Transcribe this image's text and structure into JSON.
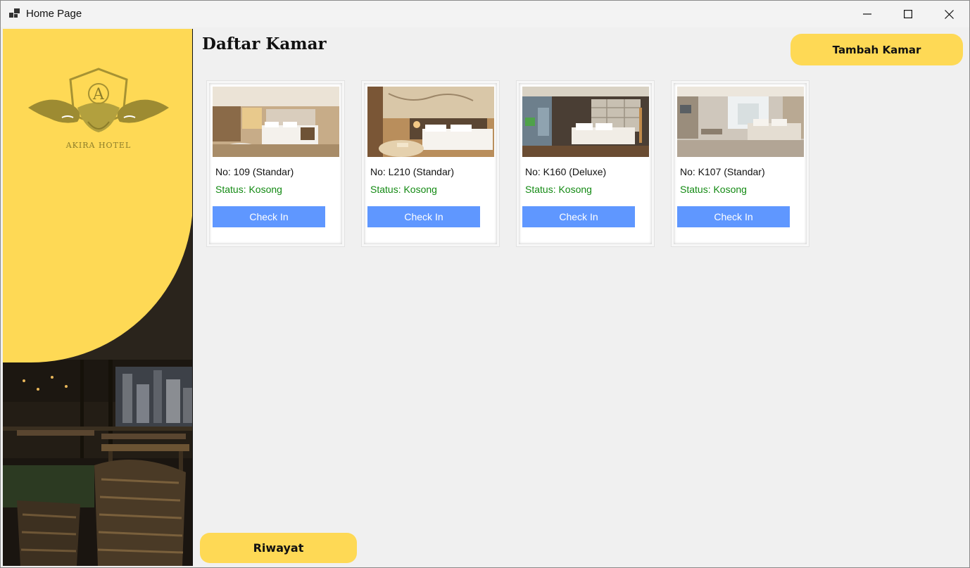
{
  "window": {
    "title": "Home Page",
    "icon": "app-window-icon",
    "controls": [
      "minimize-icon",
      "maximize-icon",
      "close-icon"
    ]
  },
  "sidebar": {
    "logo_text": "AKIRA HOTEL",
    "logo_letter": "A",
    "accent_color": "#fed955"
  },
  "main": {
    "title": "Daftar Kamar",
    "add_button_label": "Tambah Kamar",
    "history_button_label": "Riwayat"
  },
  "rooms": [
    {
      "number_label": "No: 109 (Standar)",
      "status_label": "Status: Kosong",
      "button_label": "Check In"
    },
    {
      "number_label": "No: L210 (Standar)",
      "status_label": "Status: Kosong",
      "button_label": "Check In"
    },
    {
      "number_label": "No: K160 (Deluxe)",
      "status_label": "Status: Kosong",
      "button_label": "Check In"
    },
    {
      "number_label": "No: K107 (Standar)",
      "status_label": "Status: Kosong",
      "button_label": "Check In"
    }
  ],
  "colors": {
    "accent": "#fed955",
    "button_blue": "#5f97ff",
    "status_green": "#138a13"
  }
}
